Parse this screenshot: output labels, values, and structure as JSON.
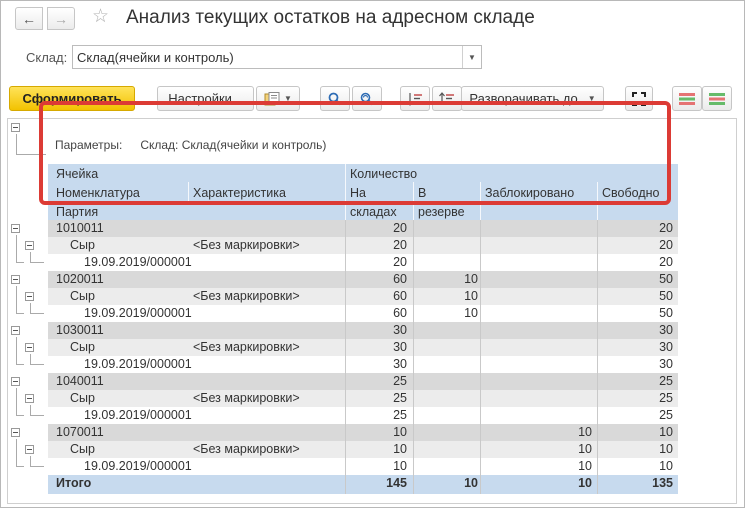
{
  "window": {
    "title": "Анализ текущих остатков на адресном складе"
  },
  "filter": {
    "warehouse_label": "Склад:",
    "warehouse_value": "Склад(ячейки и контроль)"
  },
  "toolbar": {
    "generate_label": "Сформировать",
    "settings_label": "Настройки...",
    "expand_label": "Разворачивать до"
  },
  "report": {
    "params_label": "Параметры:",
    "params_value": "Склад: Склад(ячейки и контроль)",
    "headers": {
      "cell": "Ячейка",
      "nomenclature": "Номенклатура",
      "batch": "Партия",
      "characteristic": "Характеристика",
      "quantity": "Количество",
      "in_stock_1": "На",
      "in_stock_2": "складах",
      "reserve_1": "В",
      "reserve_2": "резерве",
      "blocked": "Заблокировано",
      "free": "Свободно"
    },
    "groups": [
      {
        "cell": "1010011",
        "cell_values": [
          "20",
          "",
          "",
          "20"
        ],
        "item": "Сыр",
        "characteristic": "<Без маркировки>",
        "item_values": [
          "20",
          "",
          "",
          "20"
        ],
        "batch": "19.09.2019/000001",
        "batch_values": [
          "20",
          "",
          "",
          "20"
        ]
      },
      {
        "cell": "1020011",
        "cell_values": [
          "60",
          "10",
          "",
          "50"
        ],
        "item": "Сыр",
        "characteristic": "<Без маркировки>",
        "item_values": [
          "60",
          "10",
          "",
          "50"
        ],
        "batch": "19.09.2019/000001",
        "batch_values": [
          "60",
          "10",
          "",
          "50"
        ]
      },
      {
        "cell": "1030011",
        "cell_values": [
          "30",
          "",
          "",
          "30"
        ],
        "item": "Сыр",
        "characteristic": "<Без маркировки>",
        "item_values": [
          "30",
          "",
          "",
          "30"
        ],
        "batch": "19.09.2019/000001",
        "batch_values": [
          "30",
          "",
          "",
          "30"
        ]
      },
      {
        "cell": "1040011",
        "cell_values": [
          "25",
          "",
          "",
          "25"
        ],
        "item": "Сыр",
        "characteristic": "<Без маркировки>",
        "item_values": [
          "25",
          "",
          "",
          "25"
        ],
        "batch": "19.09.2019/000001",
        "batch_values": [
          "25",
          "",
          "",
          "25"
        ]
      },
      {
        "cell": "1070011",
        "cell_values": [
          "10",
          "",
          "10",
          "10"
        ],
        "item": "Сыр",
        "characteristic": "<Без маркировки>",
        "item_values": [
          "10",
          "",
          "10",
          "10"
        ],
        "batch": "19.09.2019/000001",
        "batch_values": [
          "10",
          "",
          "10",
          "10"
        ]
      }
    ],
    "total": {
      "label": "Итого",
      "values": [
        "145",
        "10",
        "10",
        "135"
      ]
    }
  },
  "colors": {
    "header_bg": "#c7daee",
    "generate_bg": "#f2c200",
    "highlight": "#dc3b35"
  }
}
